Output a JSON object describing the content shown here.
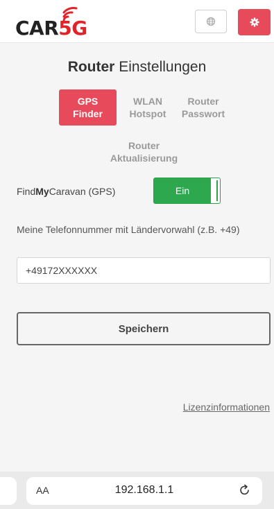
{
  "brand": {
    "part1": "CAR",
    "part2": "5G",
    "colors": {
      "accent": "#e64a5b",
      "logo_red": "#e2232a",
      "toggle_green": "#2ea84f"
    }
  },
  "header": {
    "lang_icon": "globe-icon",
    "settings_icon": "gear-icon"
  },
  "page": {
    "title_bold": "Router",
    "title_rest": "Einstellungen"
  },
  "tabs": [
    {
      "line1": "GPS",
      "line2": "Finder",
      "active": true
    },
    {
      "line1": "WLAN",
      "line2": "Hotspot",
      "active": false
    },
    {
      "line1": "Router",
      "line2": "Passwort",
      "active": false
    },
    {
      "line1": "Router",
      "line2": "Aktualisierung",
      "active": false
    }
  ],
  "gps": {
    "label_pre": "Find",
    "label_bold": "My",
    "label_post": "Caravan (GPS)",
    "toggle_label": "Ein",
    "enabled": true
  },
  "phone": {
    "label": "Meine Telefonnummer mit Ländervorwahl (z.B. +49)",
    "value": "+49172XXXXXX"
  },
  "actions": {
    "save_label": "Speichern"
  },
  "footer": {
    "license_link": "Lizenzinformationen"
  },
  "browser": {
    "aa_label": "AA",
    "url": "192.168.1.1",
    "reload_icon": "reload-icon"
  }
}
